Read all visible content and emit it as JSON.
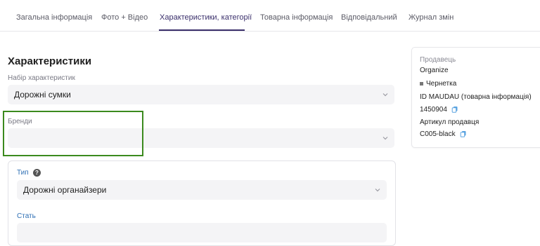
{
  "tabs": [
    {
      "label": "Загальна інформація"
    },
    {
      "label": "Фото + Відео"
    },
    {
      "label": "Характеристики, категорії"
    },
    {
      "label": "Товарна інформація"
    },
    {
      "label": "Відповідальний"
    },
    {
      "label": "Журнал змін"
    }
  ],
  "section": {
    "title": "Характеристики",
    "feature_set": {
      "label": "Набір характеристик",
      "value": "Дорожні сумки"
    },
    "brands": {
      "label": "Бренди",
      "value": ""
    }
  },
  "card": {
    "type": {
      "label": "Тип",
      "value": "Дорожні органайзери"
    },
    "gender": {
      "label": "Стать"
    }
  },
  "seller": {
    "label": "Продавець",
    "name": "Organize",
    "status": "Чернетка",
    "id_label": "ID MAUDAU (товарна інформація)",
    "id_value": "1450904",
    "article_label": "Артикул продавця",
    "article_value": "C005-black"
  },
  "colors": {
    "accent": "#3a2f6b",
    "highlight": "#3b8a1e",
    "link_label": "#2e6fb4"
  },
  "icons": [
    "chevron-down-icon",
    "help-icon",
    "copy-icon"
  ]
}
